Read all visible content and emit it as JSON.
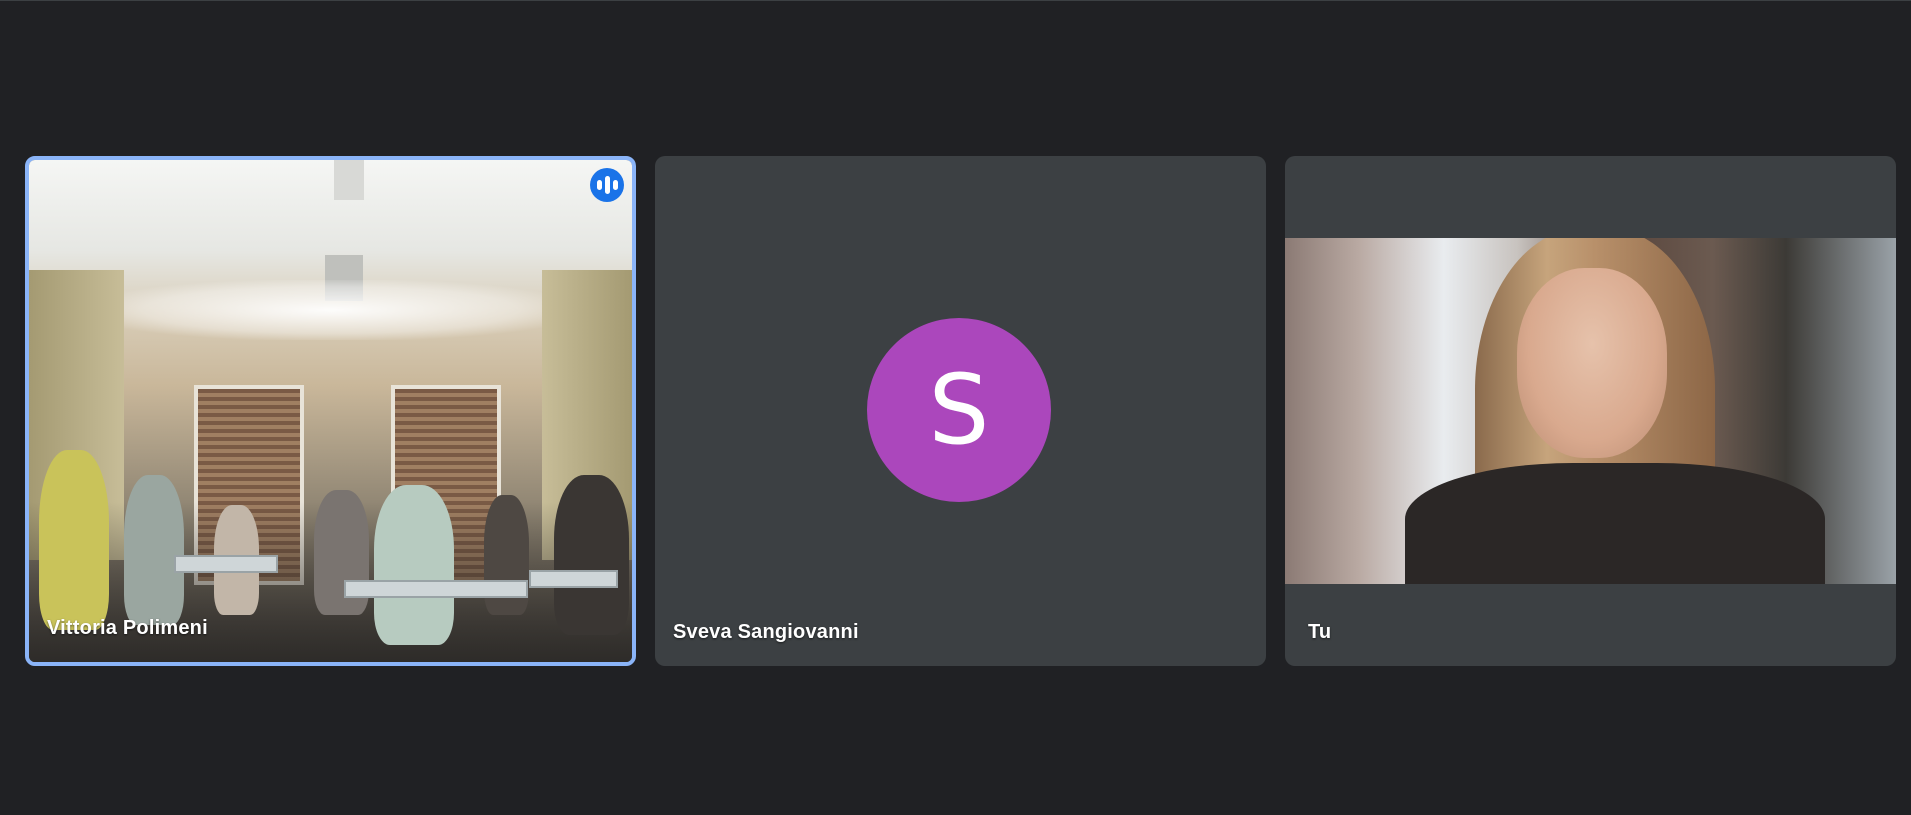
{
  "meeting": {
    "participants": [
      {
        "name": "Vittoria Polimeni",
        "speaking": true,
        "video": "classroom"
      },
      {
        "name": "Sveva Sangiovanni",
        "avatar_initial": "S",
        "avatar_color": "#ab47bc"
      },
      {
        "name": "Tu",
        "video": "self"
      }
    ],
    "active_speaker_border_color": "#8ab4f8",
    "speaking_badge_color": "#1a73e8"
  }
}
